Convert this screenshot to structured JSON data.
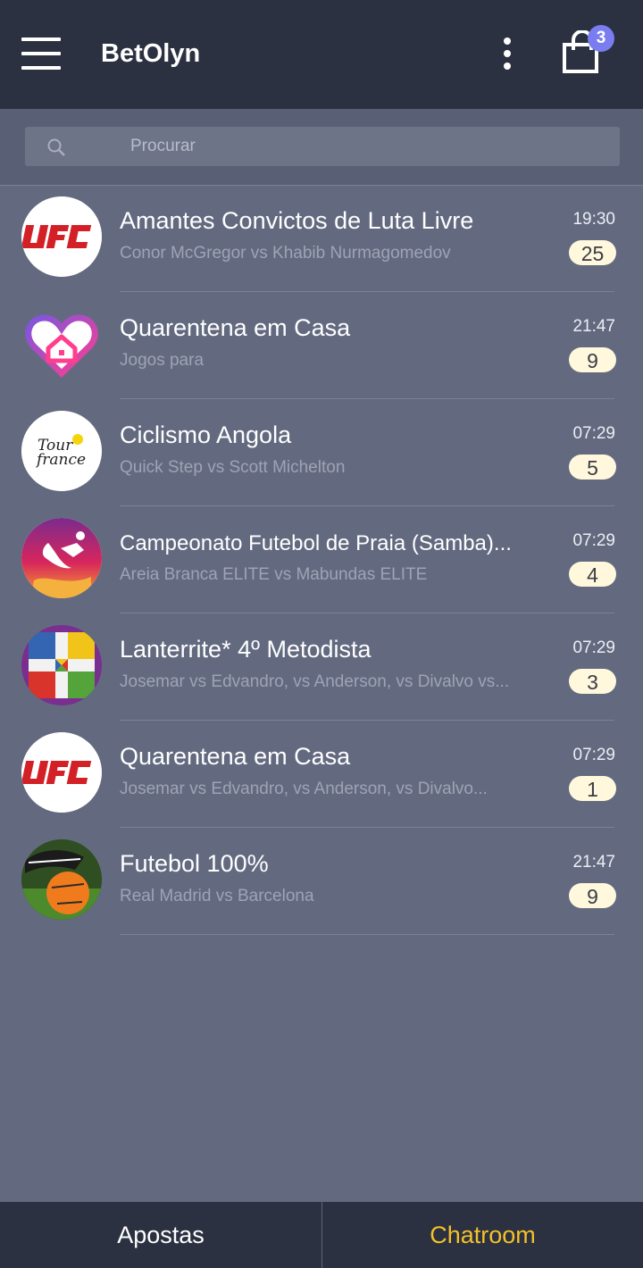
{
  "header": {
    "title": "BetOlyn",
    "cart_count": "3",
    "menu_icon": "hamburger-icon",
    "more_icon": "kebab-icon",
    "cart_icon": "shopping-bag-icon"
  },
  "search": {
    "placeholder": "Procurar",
    "icon": "search-icon"
  },
  "chats": [
    {
      "title": "Amantes Convictos de Luta Livre",
      "subtitle": "Conor McGregor vs Khabib Nurmagomedov",
      "time": "19:30",
      "unread": "25",
      "avatar": "ufc-logo"
    },
    {
      "title": "Quarentena em Casa",
      "subtitle": "Jogos para",
      "time": "21:47",
      "unread": "9",
      "avatar": "heart-house-logo"
    },
    {
      "title": "Ciclismo Angola",
      "subtitle": "Quick Step vs Scott Michelton",
      "time": "07:29",
      "unread": "5",
      "avatar": "tour-de-france-logo",
      "avatar_text": "Tour de France"
    },
    {
      "title": "Campeonato Futebol de Praia (Samba)...",
      "subtitle": "Areia Branca ELITE vs Mabundas ELITE",
      "time": "07:29",
      "unread": "4",
      "avatar": "beach-soccer-logo"
    },
    {
      "title": "Lanterrite* 4º Metodista",
      "subtitle": "Josemar vs Edvandro, vs Anderson, vs Divalvo vs...",
      "time": "07:29",
      "unread": "3",
      "avatar": "ludo-board"
    },
    {
      "title": "Quarentena em Casa",
      "subtitle": "Josemar vs Edvandro, vs Anderson, vs Divalvo...",
      "time": "07:29",
      "unread": "1",
      "avatar": "ufc-logo"
    },
    {
      "title": "Futebol 100%",
      "subtitle": "Real Madrid vs Barcelona",
      "time": "21:47",
      "unread": "9",
      "avatar": "football-photo"
    }
  ],
  "bottom_nav": {
    "left_label": "Apostas",
    "right_label": "Chatroom",
    "active_color": "#f3c12a"
  },
  "colors": {
    "topbar": "#2b3140",
    "background": "#636a80",
    "badge": "#7a7df0",
    "unread_pill": "#fff8dc"
  }
}
